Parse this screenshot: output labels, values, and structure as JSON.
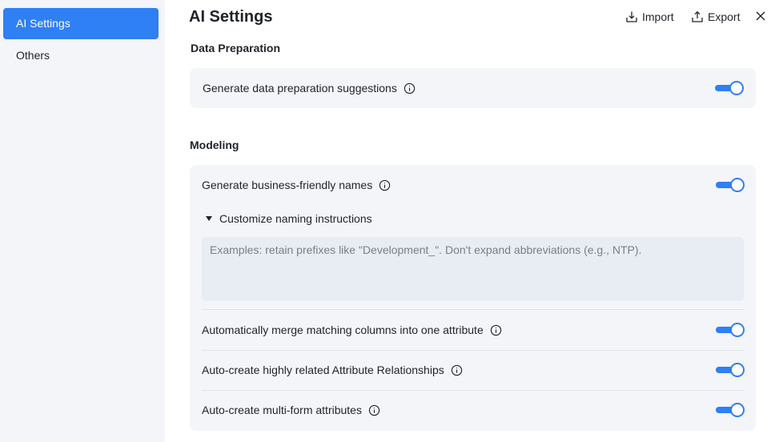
{
  "sidebar": {
    "items": [
      {
        "label": "AI Settings",
        "active": true
      },
      {
        "label": "Others",
        "active": false
      }
    ]
  },
  "header": {
    "title": "AI Settings",
    "import_label": "Import",
    "export_label": "Export"
  },
  "data_preparation": {
    "title": "Data Preparation",
    "rows": [
      {
        "label": "Generate data preparation suggestions",
        "enabled": true
      }
    ]
  },
  "modeling": {
    "title": "Modeling",
    "rows": [
      {
        "label": "Generate business-friendly names",
        "enabled": true
      },
      {
        "label": "Automatically merge matching columns into one attribute",
        "enabled": true
      },
      {
        "label": "Auto-create highly related Attribute Relationships",
        "enabled": true
      },
      {
        "label": "Auto-create multi-form attributes",
        "enabled": true
      }
    ],
    "naming_instructions": {
      "toggle_label": "Customize naming instructions",
      "expanded": true,
      "value": "",
      "placeholder": "Examples: retain prefixes like \"Development_\". Don't expand abbreviations (e.g., NTP)."
    }
  },
  "colors": {
    "accent": "#2f7ff5",
    "sidebar_bg": "#f3f5f8",
    "card_bg": "#f3f5f8"
  },
  "icons": {
    "import": "import-icon",
    "export": "export-icon",
    "close": "close-icon",
    "info": "info-icon",
    "caret": "caret-down-icon"
  }
}
